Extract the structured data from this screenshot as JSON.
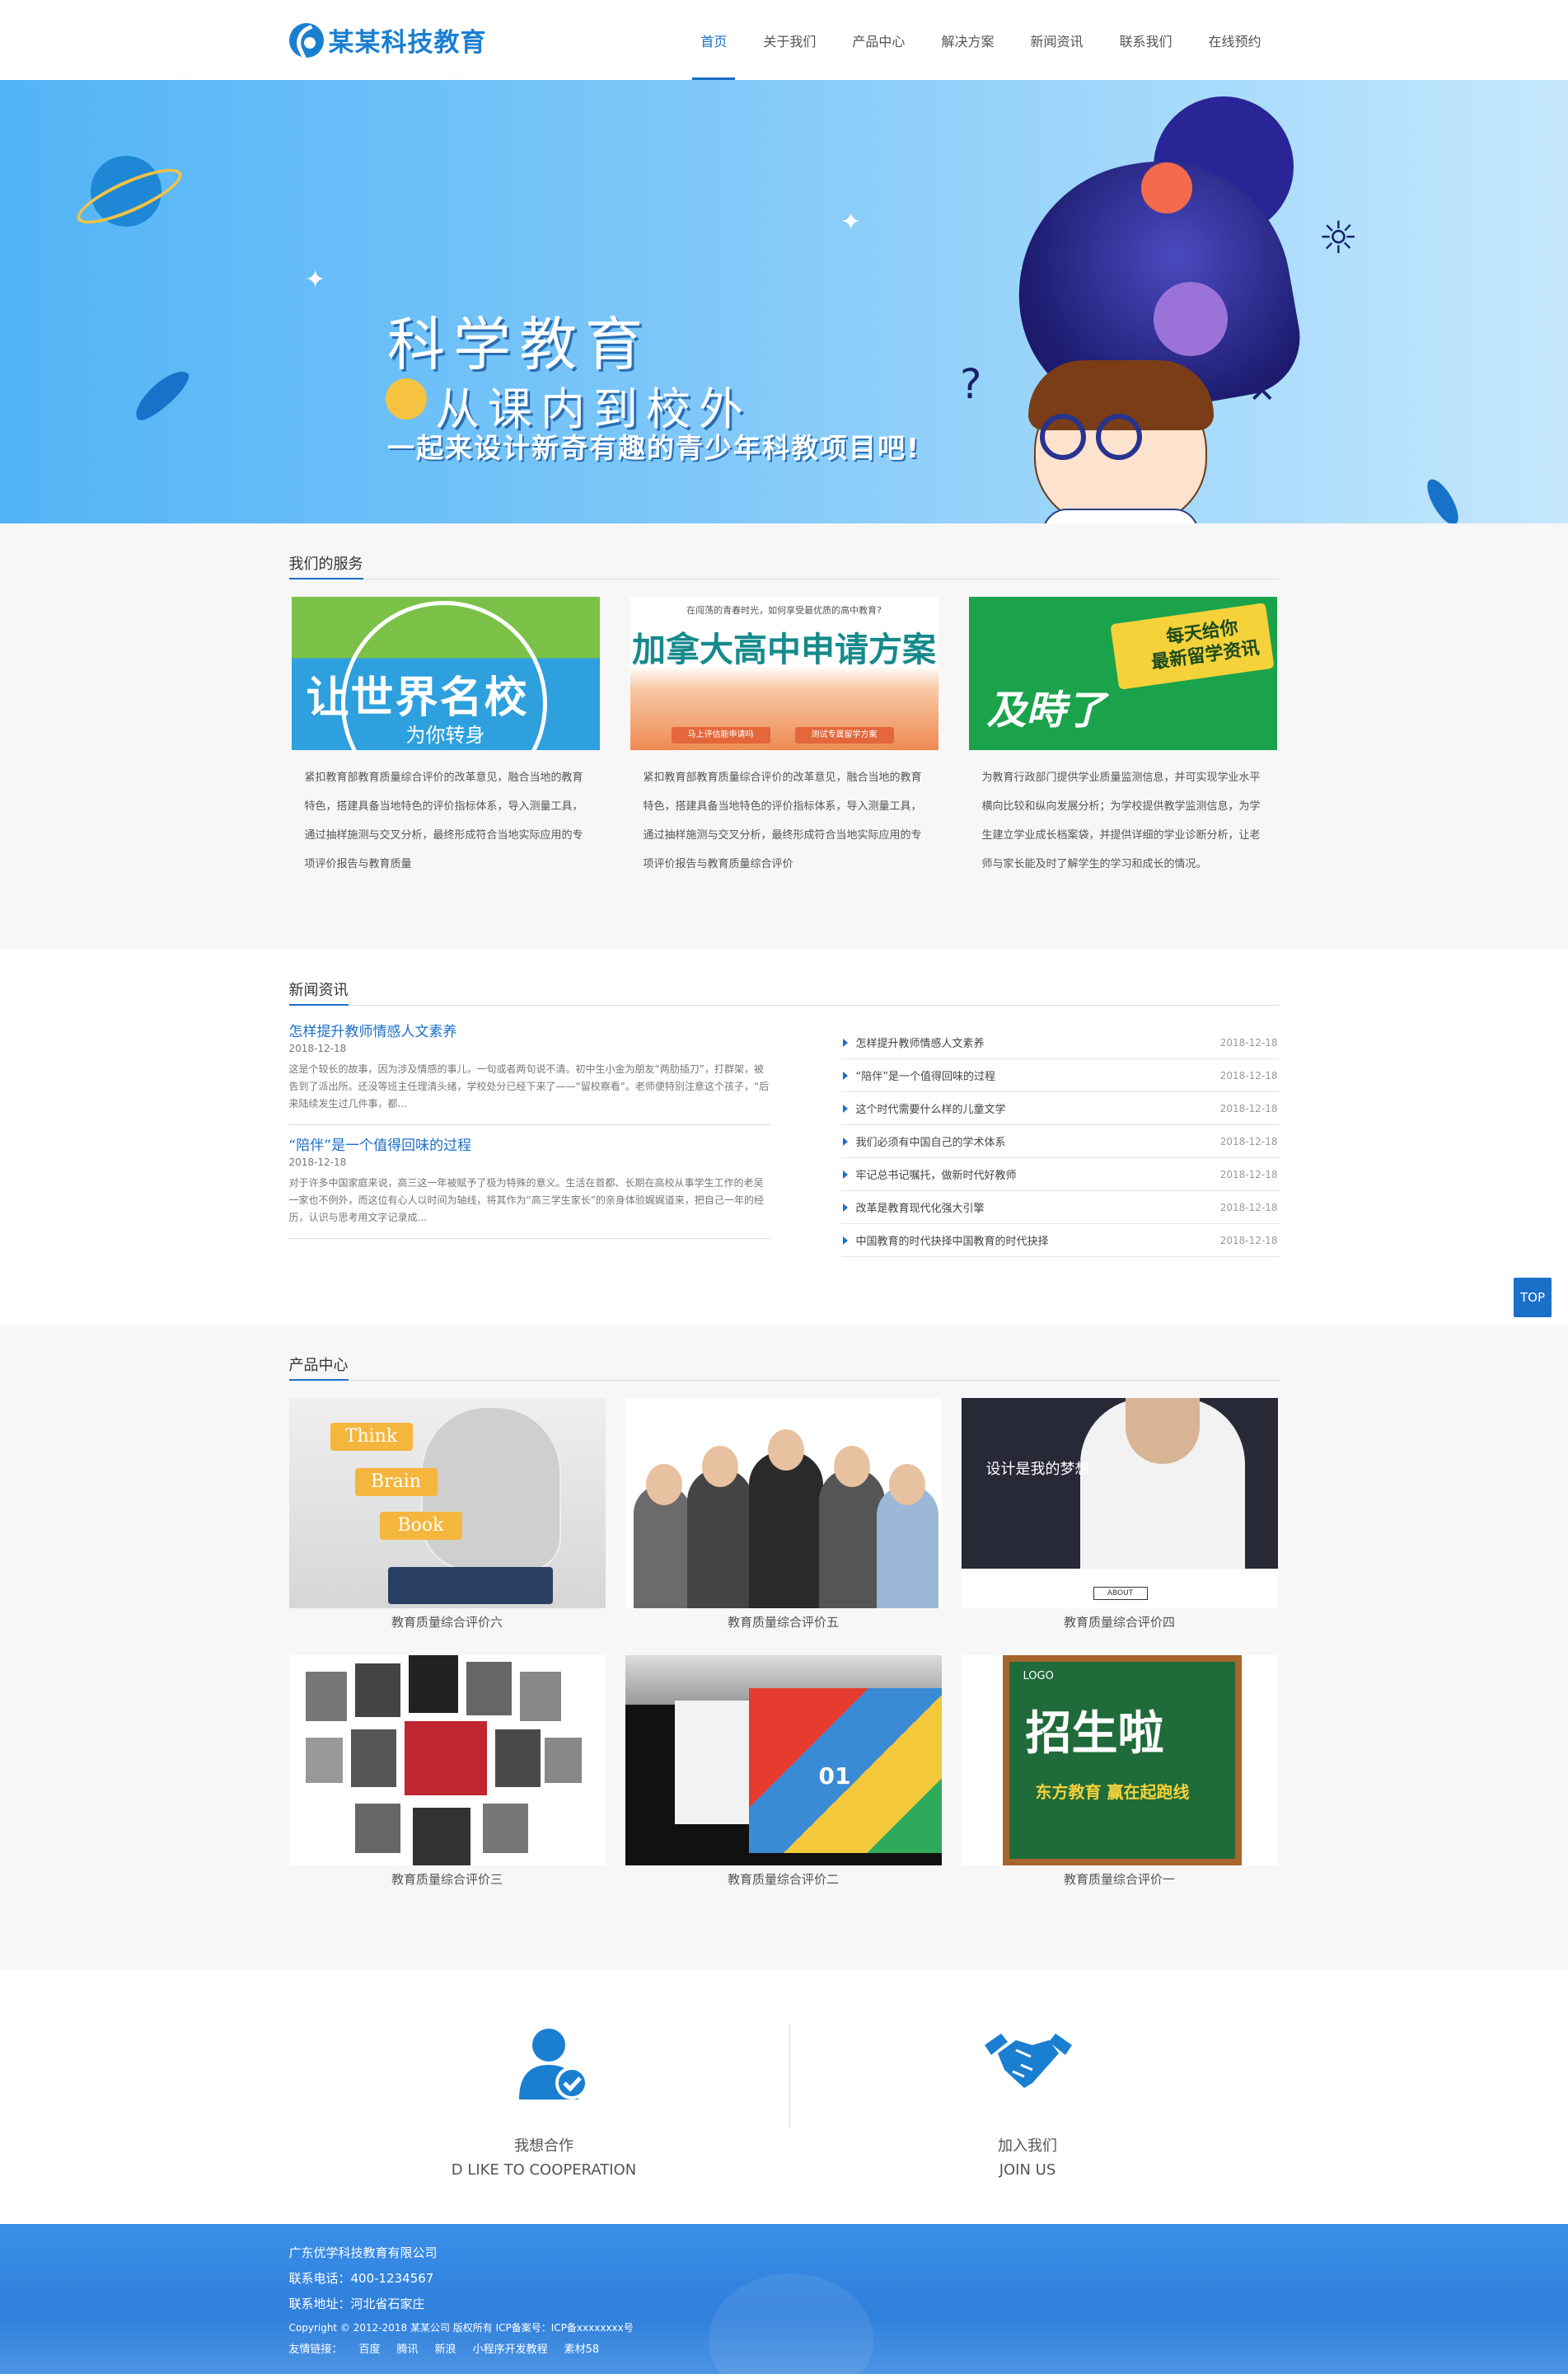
{
  "header": {
    "logo_text": "某某科技教育",
    "nav": [
      {
        "label": "首页",
        "active": true
      },
      {
        "label": "关于我们"
      },
      {
        "label": "产品中心"
      },
      {
        "label": "解决方案"
      },
      {
        "label": "新闻资讯"
      },
      {
        "label": "联系我们"
      },
      {
        "label": "在线预约"
      }
    ]
  },
  "banner": {
    "line1": "科学教育",
    "line2": "从课内到校外",
    "line3": "一起来设计新奇有趣的青少年科教项目吧!",
    "active_slide": 2,
    "slide_count": 2
  },
  "services": {
    "title": "我们的服务",
    "items": [
      {
        "image_title": "让世界名校",
        "image_subtitle": "为你转身",
        "text": "紧扣教育部教育质量综合评价的改革意见，融合当地的教育特色，搭建具备当地特色的评价指标体系，导入测量工具，通过抽样施测与交叉分析，最终形成符合当地实际应用的专项评价报告与教育质量"
      },
      {
        "image_small": "在闯荡的青春时光，如何享受最优质的高中教育?",
        "image_title": "加拿大高中申请方案",
        "image_buttons": [
          "马上评估能申请吗",
          "测试专属留学方案"
        ],
        "text": "紧扣教育部教育质量综合评价的改革意见，融合当地的教育特色，搭建具备当地特色的评价指标体系，导入测量工具，通过抽样施测与交叉分析，最终形成符合当地实际应用的专项评价报告与教育质量综合评价"
      },
      {
        "image_title": "及時了",
        "image_bubble": "每天给你\n最新留学资讯",
        "text": "为教育行政部门提供学业质量监测信息，并可实现学业水平横向比较和纵向发展分析；为学校提供教学监测信息，为学生建立学业成长档案袋，并提供详细的学业诊断分析，让老师与家长能及时了解学生的学习和成长的情况。"
      }
    ]
  },
  "news": {
    "title": "新闻资讯",
    "featured": [
      {
        "title": "怎样提升教师情感人文素养",
        "date": "2018-12-18",
        "summary": "这是个较长的故事，因为涉及情感的事儿，一句或者两句说不清。初中生小金为朋友“两肋插刀”，打群架，被告到了派出所。还没等班主任理清头绪，学校处分已经下来了——“留校察看”。老师便特别注意这个孩子，“后来陆续发生过几件事，都..."
      },
      {
        "title": "“陪伴”是一个值得回味的过程",
        "date": "2018-12-18",
        "summary": "对于许多中国家庭来说，高三这一年被赋予了极为特殊的意义。生活在首都、长期在高校从事学生工作的老吴一家也不例外，而这位有心人以时间为轴线，将其作为“高三学生家长”的亲身体验娓娓道来，把自己一年的经历，认识与思考用文字记录成..."
      }
    ],
    "list": [
      {
        "title": "怎样提升教师情感人文素养",
        "date": "2018-12-18"
      },
      {
        "title": "“陪伴”是一个值得回味的过程",
        "date": "2018-12-18"
      },
      {
        "title": "这个时代需要什么样的儿童文学",
        "date": "2018-12-18"
      },
      {
        "title": "我们必须有中国自己的学术体系",
        "date": "2018-12-18"
      },
      {
        "title": "牢记总书记嘱托，做新时代好教师",
        "date": "2018-12-18"
      },
      {
        "title": "改革是教育现代化强大引擎",
        "date": "2018-12-18"
      },
      {
        "title": "中国教育的时代抉择中国教育的时代抉择",
        "date": "2018-12-18"
      }
    ]
  },
  "products": {
    "title": "产品中心",
    "items": [
      {
        "caption": "教育质量综合评价六",
        "labels": [
          "Think",
          "Brain",
          "Book"
        ]
      },
      {
        "caption": "教育质量综合评价五"
      },
      {
        "caption": "教育质量综合评价四",
        "image_text": "设计是我的梦想",
        "image_button": "ABOUT"
      },
      {
        "caption": "教育质量综合评价三"
      },
      {
        "caption": "教育质量综合评价二",
        "image_text": "01"
      },
      {
        "caption": "教育质量综合评价一",
        "image_title": "招生啦",
        "image_sub": "东方教育 赢在起跑线",
        "image_logo": "LOGO"
      }
    ]
  },
  "cooperation": {
    "left": {
      "label_cn": "我想合作",
      "label_en": "D LIKE TO COOPERATION",
      "icon": "user-check-icon"
    },
    "right": {
      "label_cn": "加入我们",
      "label_en": "JOIN US",
      "icon": "handshake-icon"
    }
  },
  "footer": {
    "company": "广东优学科技教育有限公司",
    "phone": "联系电话：400-1234567",
    "address": "联系地址：河北省石家庄",
    "copyright": "Copyright © 2012-2018 某某公司 版权所有  ICP备案号：ICP备xxxxxxxx号",
    "links_label": "友情链接：",
    "links": [
      "百度",
      "腾讯",
      "新浪",
      "小程序开发教程",
      "素材58"
    ]
  },
  "top_button": "TOP",
  "colors": {
    "accent": "#1a6fc7",
    "footer": "#3a8fe8",
    "banner": "#52b4f6"
  }
}
